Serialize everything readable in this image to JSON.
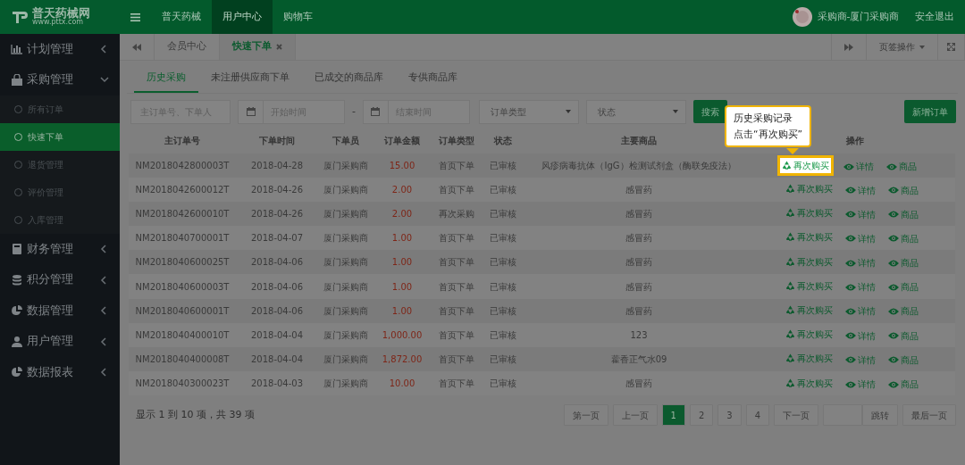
{
  "header": {
    "logo_text": "普天药械网",
    "logo_sub": "www.pttx.com",
    "nav": [
      {
        "label": "普天药械",
        "selected": false
      },
      {
        "label": "用户中心",
        "selected": true
      },
      {
        "label": "购物车",
        "selected": false
      }
    ],
    "user": "采购商-厦门采购商",
    "logout": "安全退出"
  },
  "sidebar": {
    "items": [
      {
        "label": "计划管理",
        "expanded": false
      },
      {
        "label": "采购管理",
        "expanded": true,
        "children": [
          {
            "label": "所有订单",
            "selected": false
          },
          {
            "label": "快速下单",
            "selected": true
          },
          {
            "label": "退货管理",
            "selected": false
          },
          {
            "label": "评价管理",
            "selected": false
          },
          {
            "label": "入库管理",
            "selected": false
          }
        ]
      },
      {
        "label": "财务管理",
        "expanded": false
      },
      {
        "label": "积分管理",
        "expanded": false
      },
      {
        "label": "数据管理",
        "expanded": false
      },
      {
        "label": "用户管理",
        "expanded": false
      },
      {
        "label": "数据报表",
        "expanded": false
      }
    ]
  },
  "page_tabs": [
    {
      "label": "会员中心",
      "selected": false,
      "closable": false
    },
    {
      "label": "快速下单",
      "selected": true,
      "closable": true
    }
  ],
  "tab_actions": "页签操作",
  "sub_tabs": [
    {
      "label": "历史采购",
      "selected": true
    },
    {
      "label": "未注册供应商下单",
      "selected": false
    },
    {
      "label": "已成交的商品库",
      "selected": false
    },
    {
      "label": "专供商品库",
      "selected": false
    }
  ],
  "filters": {
    "order_placeholder": "主订单号、下单人",
    "start_placeholder": "开始时间",
    "separator": "-",
    "end_placeholder": "结束时间",
    "type_select": "订单类型",
    "status_select": "状态",
    "search": "搜索",
    "add": "新增订单"
  },
  "table": {
    "columns": [
      "主订单号",
      "下单时间",
      "下单员",
      "订单金额",
      "订单类型",
      "状态",
      "主要商品",
      "操作"
    ],
    "rows": [
      {
        "cells": [
          "NM2018042800003T",
          "2018-04-28",
          "厦门采购商",
          "15.00",
          "首页下单",
          "已审核",
          "风疹病毒抗体（IgG）检测试剂盒（酶联免疫法）"
        ],
        "actions": [
          {
            "label": "再次购买",
            "kind": "rebuy",
            "highlighted": true
          },
          {
            "label": "详情",
            "kind": "view",
            "highlighted": false
          },
          {
            "label": "商品",
            "kind": "view",
            "highlighted": false
          }
        ]
      },
      {
        "cells": [
          "NM2018042600012T",
          "2018-04-26",
          "厦门采购商",
          "2.00",
          "首页下单",
          "已审核",
          "感冒药"
        ],
        "actions": [
          {
            "label": "再次购买",
            "kind": "rebuy",
            "highlighted": false
          },
          {
            "label": "详情",
            "kind": "view",
            "highlighted": false
          },
          {
            "label": "商品",
            "kind": "view",
            "highlighted": false
          }
        ]
      },
      {
        "cells": [
          "NM2018042600010T",
          "2018-04-26",
          "厦门采购商",
          "2.00",
          "再次采购",
          "已审核",
          "感冒药"
        ],
        "actions": [
          {
            "label": "再次购买",
            "kind": "rebuy",
            "highlighted": false
          },
          {
            "label": "详情",
            "kind": "view",
            "highlighted": false
          },
          {
            "label": "商品",
            "kind": "view",
            "highlighted": false
          }
        ]
      },
      {
        "cells": [
          "NM2018040700001T",
          "2018-04-07",
          "厦门采购商",
          "1.00",
          "首页下单",
          "已审核",
          "感冒药"
        ],
        "actions": [
          {
            "label": "再次购买",
            "kind": "rebuy",
            "highlighted": false
          },
          {
            "label": "详情",
            "kind": "view",
            "highlighted": false
          },
          {
            "label": "商品",
            "kind": "view",
            "highlighted": false
          }
        ]
      },
      {
        "cells": [
          "NM2018040600025T",
          "2018-04-06",
          "厦门采购商",
          "1.00",
          "首页下单",
          "已审核",
          "感冒药"
        ],
        "actions": [
          {
            "label": "再次购买",
            "kind": "rebuy",
            "highlighted": false
          },
          {
            "label": "详情",
            "kind": "view",
            "highlighted": false
          },
          {
            "label": "商品",
            "kind": "view",
            "highlighted": false
          }
        ]
      },
      {
        "cells": [
          "NM2018040600003T",
          "2018-04-06",
          "厦门采购商",
          "1.00",
          "首页下单",
          "已审核",
          "感冒药"
        ],
        "actions": [
          {
            "label": "再次购买",
            "kind": "rebuy",
            "highlighted": false
          },
          {
            "label": "详情",
            "kind": "view",
            "highlighted": false
          },
          {
            "label": "商品",
            "kind": "view",
            "highlighted": false
          }
        ]
      },
      {
        "cells": [
          "NM2018040600001T",
          "2018-04-06",
          "厦门采购商",
          "1.00",
          "首页下单",
          "已审核",
          "感冒药"
        ],
        "actions": [
          {
            "label": "再次购买",
            "kind": "rebuy",
            "highlighted": false
          },
          {
            "label": "详情",
            "kind": "view",
            "highlighted": false
          },
          {
            "label": "商品",
            "kind": "view",
            "highlighted": false
          }
        ]
      },
      {
        "cells": [
          "NM2018040400010T",
          "2018-04-04",
          "厦门采购商",
          "1,000.00",
          "首页下单",
          "已审核",
          "123"
        ],
        "actions": [
          {
            "label": "再次购买",
            "kind": "rebuy",
            "highlighted": false
          },
          {
            "label": "详情",
            "kind": "view",
            "highlighted": false
          },
          {
            "label": "商品",
            "kind": "view",
            "highlighted": false
          }
        ]
      },
      {
        "cells": [
          "NM2018040400008T",
          "2018-04-04",
          "厦门采购商",
          "1,872.00",
          "首页下单",
          "已审核",
          "藿香正气水09"
        ],
        "actions": [
          {
            "label": "再次购买",
            "kind": "rebuy",
            "highlighted": false
          },
          {
            "label": "详情",
            "kind": "view",
            "highlighted": false
          },
          {
            "label": "商品",
            "kind": "view",
            "highlighted": false
          }
        ]
      },
      {
        "cells": [
          "NM2018040300023T",
          "2018-04-03",
          "厦门采购商",
          "10.00",
          "首页下单",
          "已审核",
          "感冒药"
        ],
        "actions": [
          {
            "label": "再次购买",
            "kind": "rebuy",
            "highlighted": false
          },
          {
            "label": "详情",
            "kind": "view",
            "highlighted": false
          },
          {
            "label": "商品",
            "kind": "view",
            "highlighted": false
          }
        ]
      }
    ]
  },
  "callout": [
    "历史采购记录",
    "点击“再次购买”"
  ],
  "summary": "显示 1 到 10 项，共 39 项",
  "pagination": {
    "first": "第一页",
    "prev": "上一页",
    "pages": [
      {
        "label": "1",
        "selected": true
      },
      {
        "label": "2",
        "selected": false
      },
      {
        "label": "3",
        "selected": false
      },
      {
        "label": "4",
        "selected": false
      }
    ],
    "next": "下一页",
    "jump": "跳转",
    "last": "最后一页"
  }
}
